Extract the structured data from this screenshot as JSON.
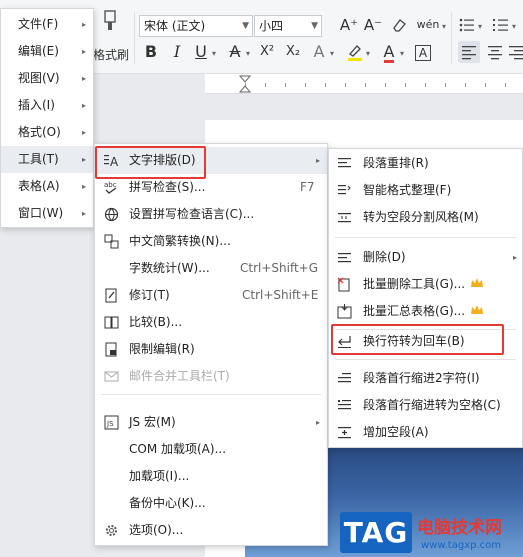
{
  "toolbar": {
    "format_painter_label": "格式刷",
    "font_name": "宋体 (正文)",
    "font_size": "小四",
    "bold": "B",
    "italic": "I",
    "underline": "U",
    "strikethrough": "A",
    "superscript": "X²",
    "subscript": "X₂",
    "text_effect": "A",
    "highlight": "A",
    "font_color": "A",
    "char_border": "A",
    "grow_font": "A⁺",
    "shrink_font": "A⁻",
    "pinyin": "wén",
    "colors": {
      "highlight": "#f3e600",
      "font_color": "#e53935",
      "accent": "#3c66a6"
    }
  },
  "menu_main": {
    "items": [
      {
        "label": "文件(F)"
      },
      {
        "label": "编辑(E)"
      },
      {
        "label": "视图(V)"
      },
      {
        "label": "插入(I)"
      },
      {
        "label": "格式(O)"
      },
      {
        "label": "工具(T)"
      },
      {
        "label": "表格(A)"
      },
      {
        "label": "窗口(W)"
      }
    ]
  },
  "menu_tools": {
    "items": [
      {
        "label": "文字排版(D)",
        "icon": "text-layout-icon"
      },
      {
        "label": "拼写检查(S)...",
        "icon": "spellcheck-icon",
        "shortcut": "F7"
      },
      {
        "label": "设置拼写检查语言(C)...",
        "icon": "language-icon"
      },
      {
        "label": "中文简繁转换(N)...",
        "icon": "convert-icon"
      },
      {
        "label": "字数统计(W)...",
        "shortcut": "Ctrl+Shift+G"
      },
      {
        "label": "修订(T)",
        "icon": "revision-icon",
        "shortcut": "Ctrl+Shift+E"
      },
      {
        "label": "比较(B)...",
        "icon": "compare-icon"
      },
      {
        "label": "限制编辑(R)",
        "icon": "lock-icon"
      },
      {
        "label": "邮件合并工具栏(T)",
        "icon": "mail-icon"
      },
      {
        "label": "JS 宏(M)",
        "icon": "js-macro-icon"
      },
      {
        "label": "COM 加载项(A)..."
      },
      {
        "label": "加载项(I)..."
      },
      {
        "label": "备份中心(K)..."
      },
      {
        "label": "选项(O)...",
        "icon": "gear-icon"
      }
    ]
  },
  "menu_layout": {
    "items": [
      {
        "label": "段落重排(R)",
        "icon": "paragraph-rearrange-icon"
      },
      {
        "label": "智能格式整理(F)",
        "icon": "smart-format-icon"
      },
      {
        "label": "转为空段分割风格(M)",
        "icon": "empty-paragraph-icon"
      },
      {
        "label": "删除(D)",
        "icon": "delete-icon"
      },
      {
        "label": "批量删除工具(G)...",
        "icon": "batch-delete-icon"
      },
      {
        "label": "批量汇总表格(G)...",
        "icon": "batch-table-icon"
      },
      {
        "label": "换行符转为回车(B)",
        "icon": "line-break-icon"
      },
      {
        "label": "段落首行缩进2字符(I)",
        "icon": "indent-2-icon"
      },
      {
        "label": "段落首行缩进转为空格(C)",
        "icon": "indent-space-icon"
      },
      {
        "label": "增加空段(A)",
        "icon": "add-paragraph-icon"
      }
    ]
  },
  "watermark": {
    "tag": "TAG",
    "title": "电脑技术网",
    "url": "www.tagxp.com"
  }
}
